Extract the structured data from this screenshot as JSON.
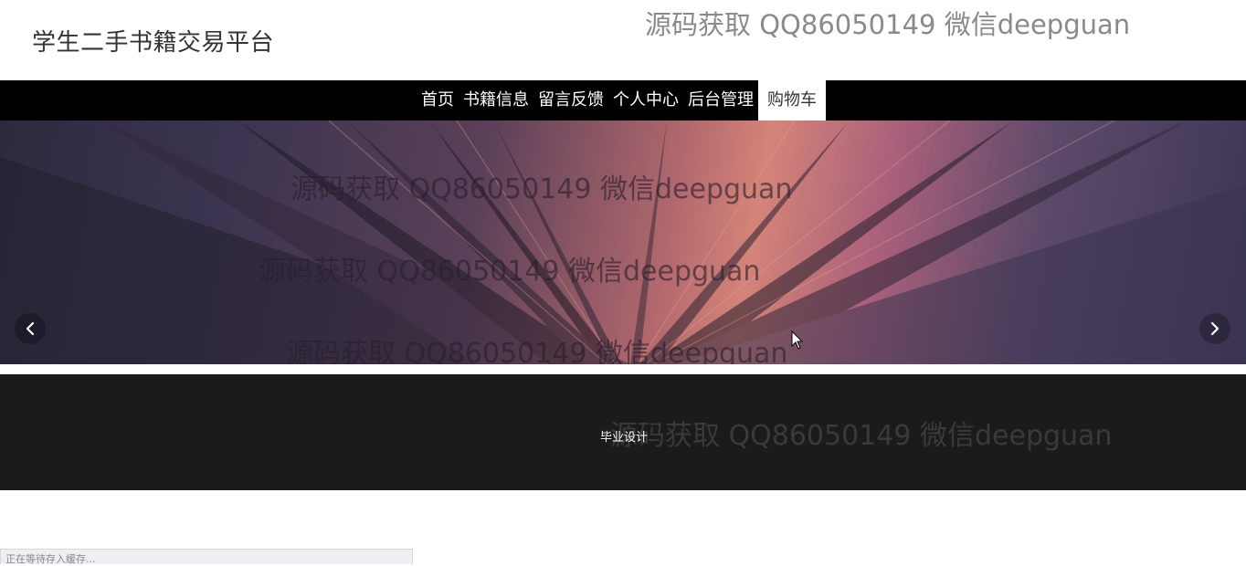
{
  "header": {
    "site_title": "学生二手书籍交易平台",
    "watermark": "源码获取 QQ86050149 微信deepguan"
  },
  "nav": {
    "items": [
      {
        "label": "首页"
      },
      {
        "label": "书籍信息"
      },
      {
        "label": "留言反馈"
      },
      {
        "label": "个人中心"
      },
      {
        "label": "后台管理"
      },
      {
        "label": "购物车",
        "active": true
      }
    ]
  },
  "banner": {
    "watermarks": [
      "源码获取 QQ86050149 微信deepguan",
      "源码获取 QQ86050149 微信deepguan",
      "源码获取 QQ86050149 微信deepguan"
    ],
    "prev_icon": "chevron-left-icon",
    "next_icon": "chevron-right-icon"
  },
  "footer": {
    "text": "毕业设计",
    "watermark": "源码获取 QQ86050149 微信deepguan"
  },
  "status_bar": {
    "text": "正在等待存入缓存..."
  },
  "colors": {
    "nav_bg": "#000000",
    "footer_bg": "#1b1b1b",
    "active_nav_bg": "#ffffff"
  }
}
